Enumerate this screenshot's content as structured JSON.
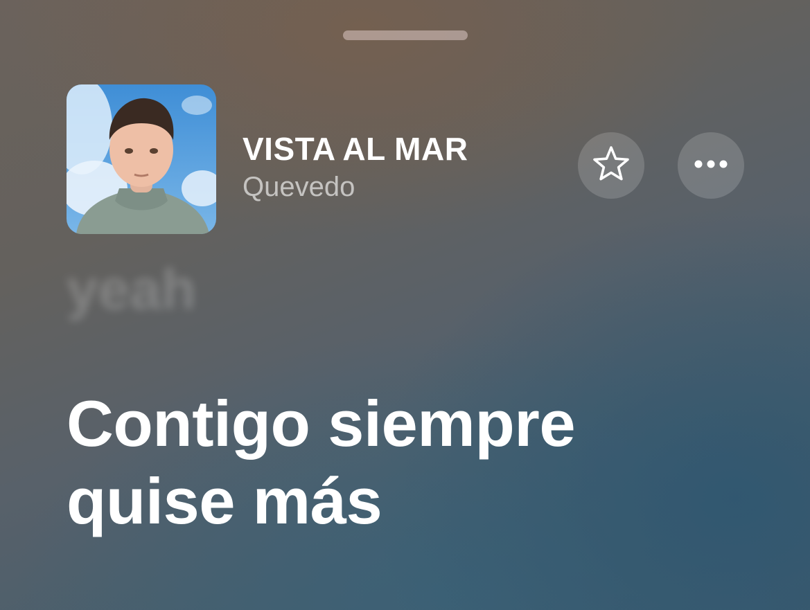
{
  "sheet": {
    "grabber_icon": "grabber-handle-icon"
  },
  "now_playing": {
    "artwork_icon": "album-artwork",
    "title": "VISTA AL MAR",
    "artist": "Quevedo",
    "favorite_icon": "star-outline-icon",
    "more_icon": "ellipsis-icon"
  },
  "lyrics": {
    "previous_line": "yeah",
    "current_line_1": "Contigo siempre",
    "current_line_2": "quise más"
  },
  "colors": {
    "text_primary": "#ffffff",
    "text_secondary": "rgba(255,255,255,0.62)",
    "button_fill": "rgba(255,255,255,0.16)",
    "grabber": "rgba(220,200,196,0.55)"
  }
}
